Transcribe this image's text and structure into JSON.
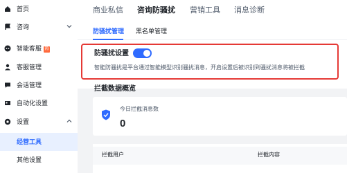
{
  "sidebar": {
    "items": [
      {
        "label": "首页",
        "icon": "home-icon"
      },
      {
        "label": "咨询",
        "icon": "flag-icon",
        "expandable": true
      },
      {
        "label": "智能客服",
        "icon": "robot-icon",
        "badge": "hot-badge"
      },
      {
        "label": "客服管理",
        "icon": "user-icon"
      },
      {
        "label": "会话管理",
        "icon": "chat-icon"
      },
      {
        "label": "自动化设置",
        "icon": "automation-icon"
      },
      {
        "label": "设置",
        "icon": "settings-icon",
        "expandable": true
      },
      {
        "label": "经营工具",
        "active": true
      },
      {
        "label": "其他设置"
      }
    ]
  },
  "top_tabs": [
    "商业私信",
    "咨询防骚扰",
    "营销工具",
    "消息诊断"
  ],
  "sub_tabs": [
    "防骚扰管理",
    "黑名单管理"
  ],
  "setting": {
    "title": "防骚扰设置",
    "enabled": true,
    "description": "智能防骚扰是平台通过智能模型识别骚扰消息，开启设置后被识别到骚扰消息将被拦截"
  },
  "overview": {
    "title": "拦截数据概览",
    "stat_label": "今日拦截消息数",
    "stat_value": "0"
  },
  "table": {
    "headers": [
      "拦截用户",
      "拦截内容"
    ]
  },
  "colors": {
    "accent": "#2f6bff",
    "highlight": "#e53935",
    "badge": "#ff6a3d"
  }
}
